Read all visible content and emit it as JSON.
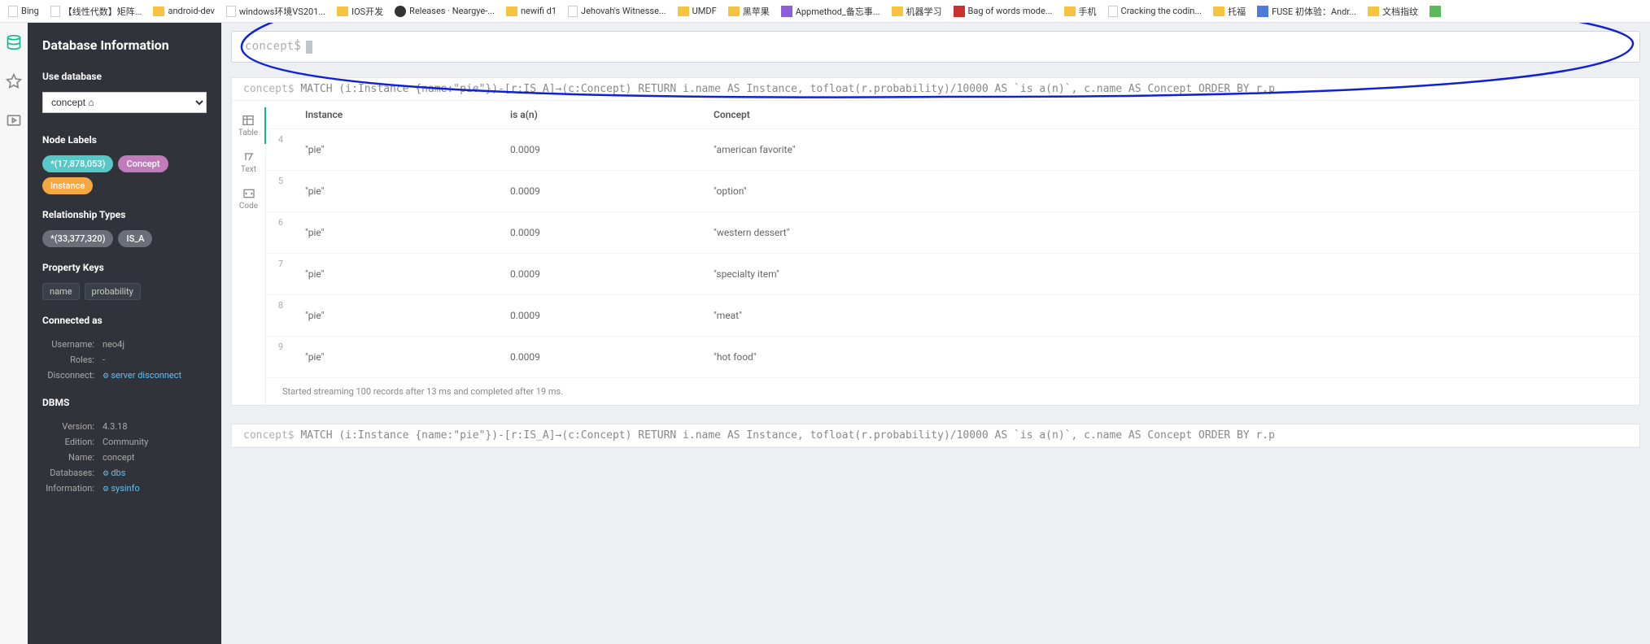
{
  "bookmarks": [
    {
      "icon": "page",
      "label": "Bing"
    },
    {
      "icon": "page",
      "label": "【线性代数】矩阵..."
    },
    {
      "icon": "folder",
      "label": "android-dev"
    },
    {
      "icon": "page",
      "label": "windows环境VS201..."
    },
    {
      "icon": "folder",
      "label": "IOS开发"
    },
    {
      "icon": "github",
      "label": "Releases · Neargye-..."
    },
    {
      "icon": "folder",
      "label": "newifi d1"
    },
    {
      "icon": "page",
      "label": "Jehovah's Witnesse..."
    },
    {
      "icon": "folder",
      "label": "UMDF"
    },
    {
      "icon": "folder",
      "label": "黑苹果"
    },
    {
      "icon": "app",
      "label": "Appmethod_备忘事..."
    },
    {
      "icon": "folder",
      "label": "机器学习"
    },
    {
      "icon": "red",
      "label": "Bag of words mode..."
    },
    {
      "icon": "folder",
      "label": "手机"
    },
    {
      "icon": "page",
      "label": "Cracking the codin..."
    },
    {
      "icon": "folder",
      "label": "托福"
    },
    {
      "icon": "blue",
      "label": "FUSE 初体验：Andr..."
    },
    {
      "icon": "folder",
      "label": "文档指纹"
    },
    {
      "icon": "green",
      "label": ""
    }
  ],
  "sidebar": {
    "title": "Database Information",
    "use_db": "Use database",
    "db_selected": "concept ⌂",
    "node_labels_h": "Node Labels",
    "labels": [
      {
        "cls": "teal",
        "text": "*(17,878,053)"
      },
      {
        "cls": "purple",
        "text": "Concept"
      },
      {
        "cls": "orange",
        "text": "Instance"
      }
    ],
    "rel_types_h": "Relationship Types",
    "rels": [
      {
        "cls": "grey",
        "text": "*(33,377,320)"
      },
      {
        "cls": "grey",
        "text": "IS_A"
      }
    ],
    "prop_keys_h": "Property Keys",
    "props": [
      "name",
      "probability"
    ],
    "connected_h": "Connected as",
    "conn": {
      "Username": "neo4j",
      "Roles": "-",
      "Disconnect": "server disconnect"
    },
    "dbms_h": "DBMS",
    "dbms": {
      "Version": "4.3.18",
      "Edition": "Community",
      "Name": "concept",
      "Databases": "dbs",
      "Information": "sysinfo"
    }
  },
  "prompt": "concept$",
  "query_text": "MATCH (i:Instance {name:\"pie\"})-[r:IS_A]→(c:Concept) RETURN i.name AS Instance, tofloat(r.probability)/10000 AS `is a(n)`, c.name AS Concept ORDER BY r.p",
  "view_tabs": {
    "table": "Table",
    "text": "Text",
    "code": "Code"
  },
  "columns": {
    "instance": "Instance",
    "isa": "is a(n)",
    "concept": "Concept"
  },
  "rows": [
    {
      "idx": "4",
      "instance": "\"pie\"",
      "isa": "0.0009",
      "concept": "\"american favorite\""
    },
    {
      "idx": "5",
      "instance": "\"pie\"",
      "isa": "0.0009",
      "concept": "\"option\""
    },
    {
      "idx": "6",
      "instance": "\"pie\"",
      "isa": "0.0009",
      "concept": "\"western dessert\""
    },
    {
      "idx": "7",
      "instance": "\"pie\"",
      "isa": "0.0009",
      "concept": "\"specialty item\""
    },
    {
      "idx": "8",
      "instance": "\"pie\"",
      "isa": "0.0009",
      "concept": "\"meat\""
    },
    {
      "idx": "9",
      "instance": "\"pie\"",
      "isa": "0.0009",
      "concept": "\"hot food\""
    }
  ],
  "footer": "Started streaming 100 records after 13 ms and completed after 19 ms.",
  "query2_text": "MATCH (i:Instance {name:\"pie\"})-[r:IS_A]→(c:Concept) RETURN i.name AS Instance, tofloat(r.probability)/10000 AS `is a(n)`, c.name AS Concept ORDER BY r.p"
}
